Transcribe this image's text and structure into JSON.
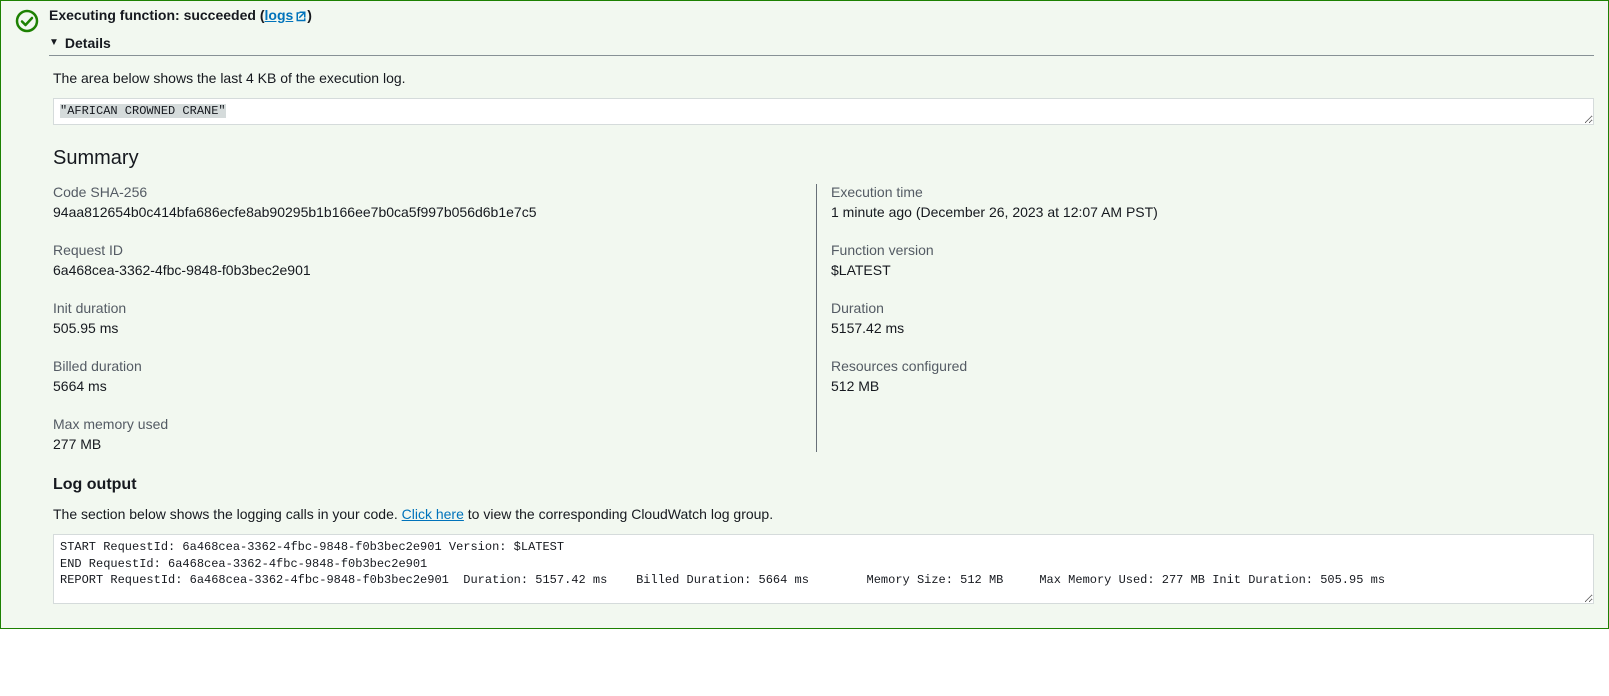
{
  "status": {
    "prefix": "Executing function: ",
    "state": "succeeded",
    "open_paren": " (",
    "logs_link_text": "logs",
    "close_paren": ")"
  },
  "details": {
    "toggle_label": "Details",
    "description": "The area below shows the last 4 KB of the execution log.",
    "result_output": "\"AFRICAN CROWNED CRANE\""
  },
  "summary": {
    "heading": "Summary",
    "left": [
      {
        "label": "Code SHA-256",
        "value": "94aa812654b0c414bfa686ecfe8ab90295b1b166ee7b0ca5f997b056d6b1e7c5"
      },
      {
        "label": "Request ID",
        "value": "6a468cea-3362-4fbc-9848-f0b3bec2e901"
      },
      {
        "label": "Init duration",
        "value": "505.95 ms"
      },
      {
        "label": "Billed duration",
        "value": "5664 ms"
      },
      {
        "label": "Max memory used",
        "value": "277 MB"
      }
    ],
    "right": [
      {
        "label": "Execution time",
        "value": "1 minute ago (December 26, 2023 at 12:07 AM PST)"
      },
      {
        "label": "Function version",
        "value": "$LATEST"
      },
      {
        "label": "Duration",
        "value": "5157.42 ms"
      },
      {
        "label": "Resources configured",
        "value": "512 MB"
      }
    ]
  },
  "log_output": {
    "heading": "Log output",
    "desc_prefix": "The section below shows the logging calls in your code. ",
    "click_here": "Click here",
    "desc_suffix": " to view the corresponding CloudWatch log group.",
    "content": "START RequestId: 6a468cea-3362-4fbc-9848-f0b3bec2e901 Version: $LATEST\nEND RequestId: 6a468cea-3362-4fbc-9848-f0b3bec2e901\nREPORT RequestId: 6a468cea-3362-4fbc-9848-f0b3bec2e901  Duration: 5157.42 ms    Billed Duration: 5664 ms        Memory Size: 512 MB     Max Memory Used: 277 MB Init Duration: 505.95 ms"
  }
}
